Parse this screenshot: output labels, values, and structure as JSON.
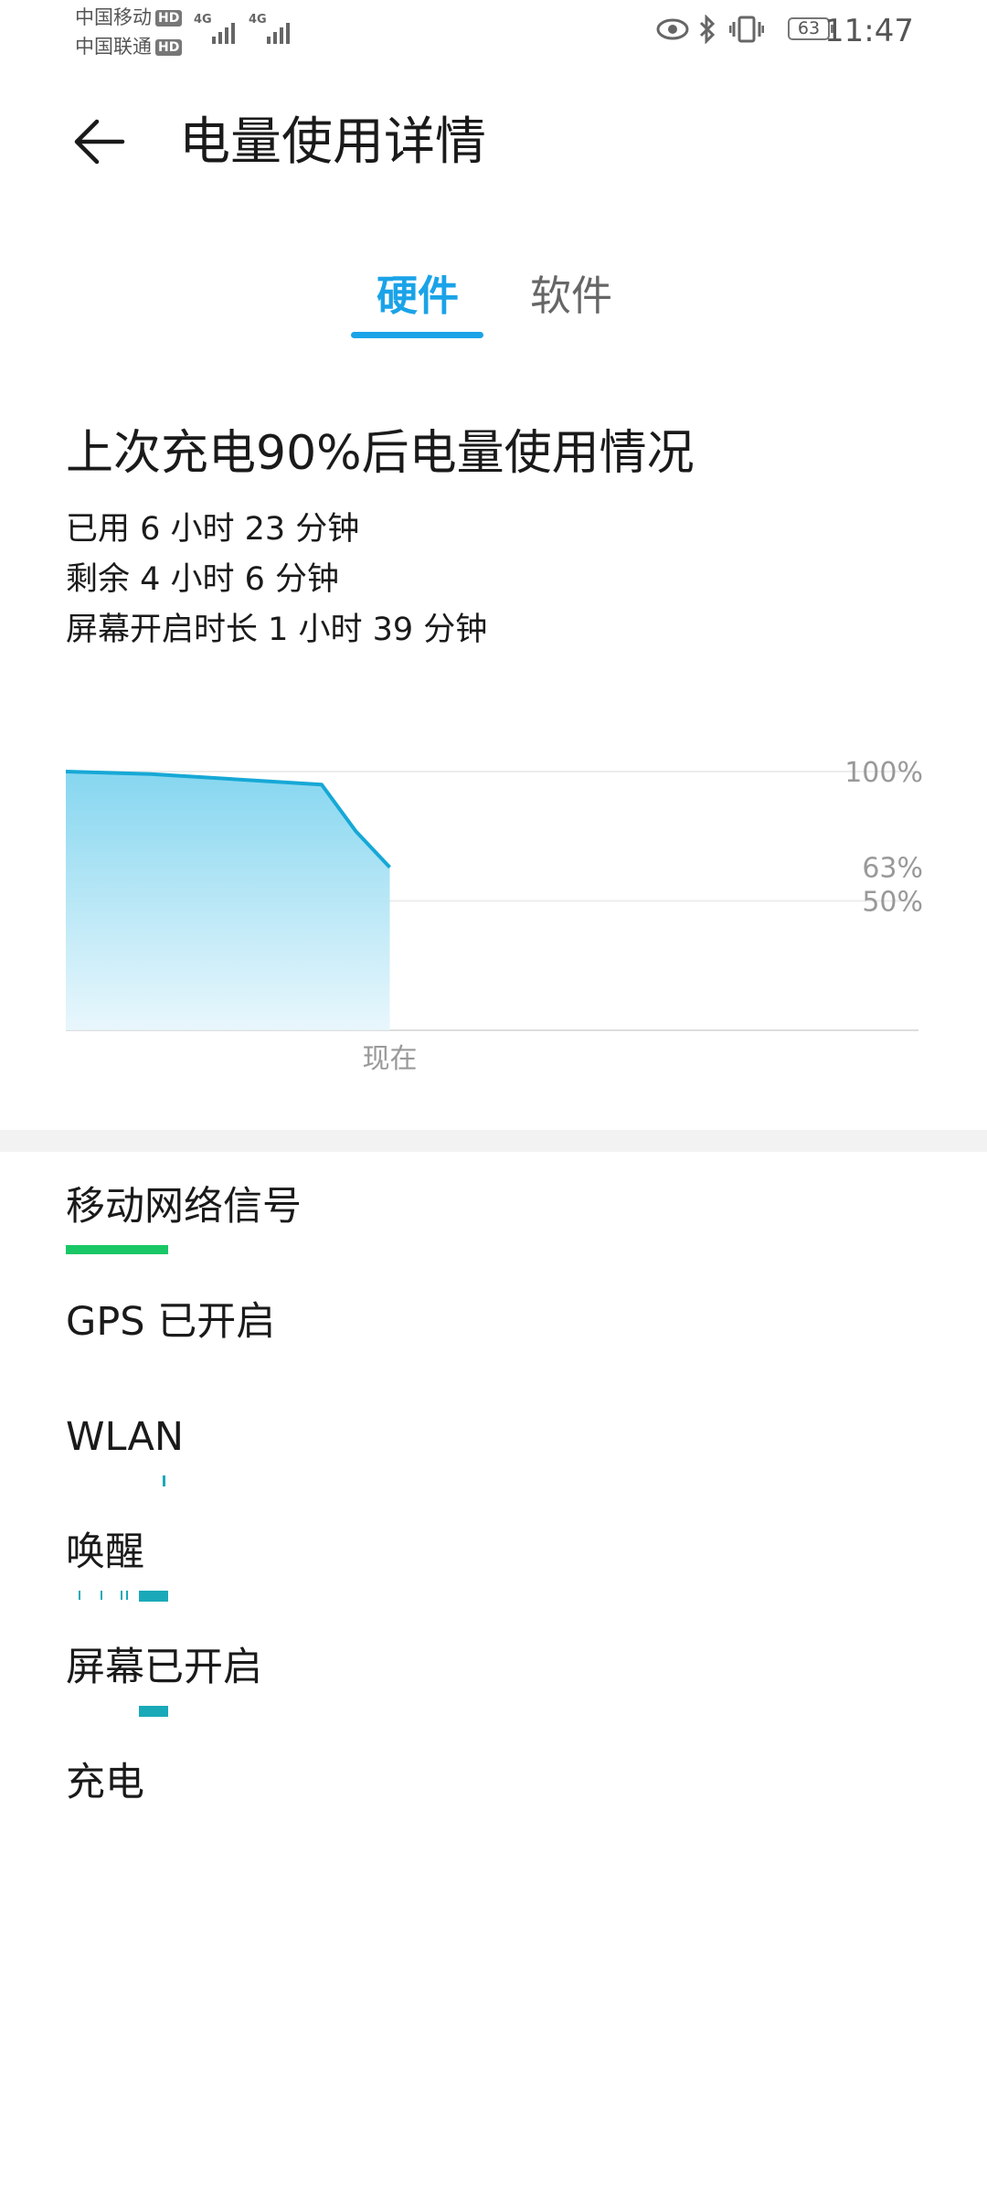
{
  "status_bar": {
    "carrier1": "中国移动",
    "carrier2": "中国联通",
    "hd_label": "HD",
    "network_type": "4G",
    "battery": "63",
    "time": "11:47"
  },
  "header": {
    "back_icon": "arrow-left-icon",
    "title": "电量使用详情"
  },
  "tabs": [
    {
      "label": "硬件",
      "selected": true
    },
    {
      "label": "软件",
      "selected": false
    }
  ],
  "accent_color": "#1aa3e8",
  "summary": {
    "title": "上次充电90%后电量使用情况",
    "used": "已用 6 小时 23 分钟",
    "remaining": "剩余 4 小时 6 分钟",
    "screen_on": "屏幕开启时长 1 小时 39 分钟"
  },
  "chart_data": {
    "type": "area",
    "title": "",
    "x_label": "现在",
    "y_ticks": [
      "100%",
      "63%",
      "50%"
    ],
    "ylim": [
      0,
      100
    ],
    "x": [
      0,
      0.1,
      0.3,
      0.34,
      0.38
    ],
    "values": [
      100,
      99,
      95,
      77,
      63
    ],
    "current_value": 63,
    "fill_color": "#7fd4ef",
    "line_color": "#16a8d6",
    "grid": true
  },
  "hardware_items": [
    {
      "label": "移动网络信号",
      "bar_color": "#19c766"
    },
    {
      "label": "GPS 已开启"
    },
    {
      "label": "WLAN",
      "bar_color": "#1aa9b8"
    },
    {
      "label": "唤醒",
      "bar_color": "#1aa9b8"
    },
    {
      "label": "屏幕已开启",
      "bar_color": "#1aa9b8"
    },
    {
      "label": "充电"
    }
  ]
}
